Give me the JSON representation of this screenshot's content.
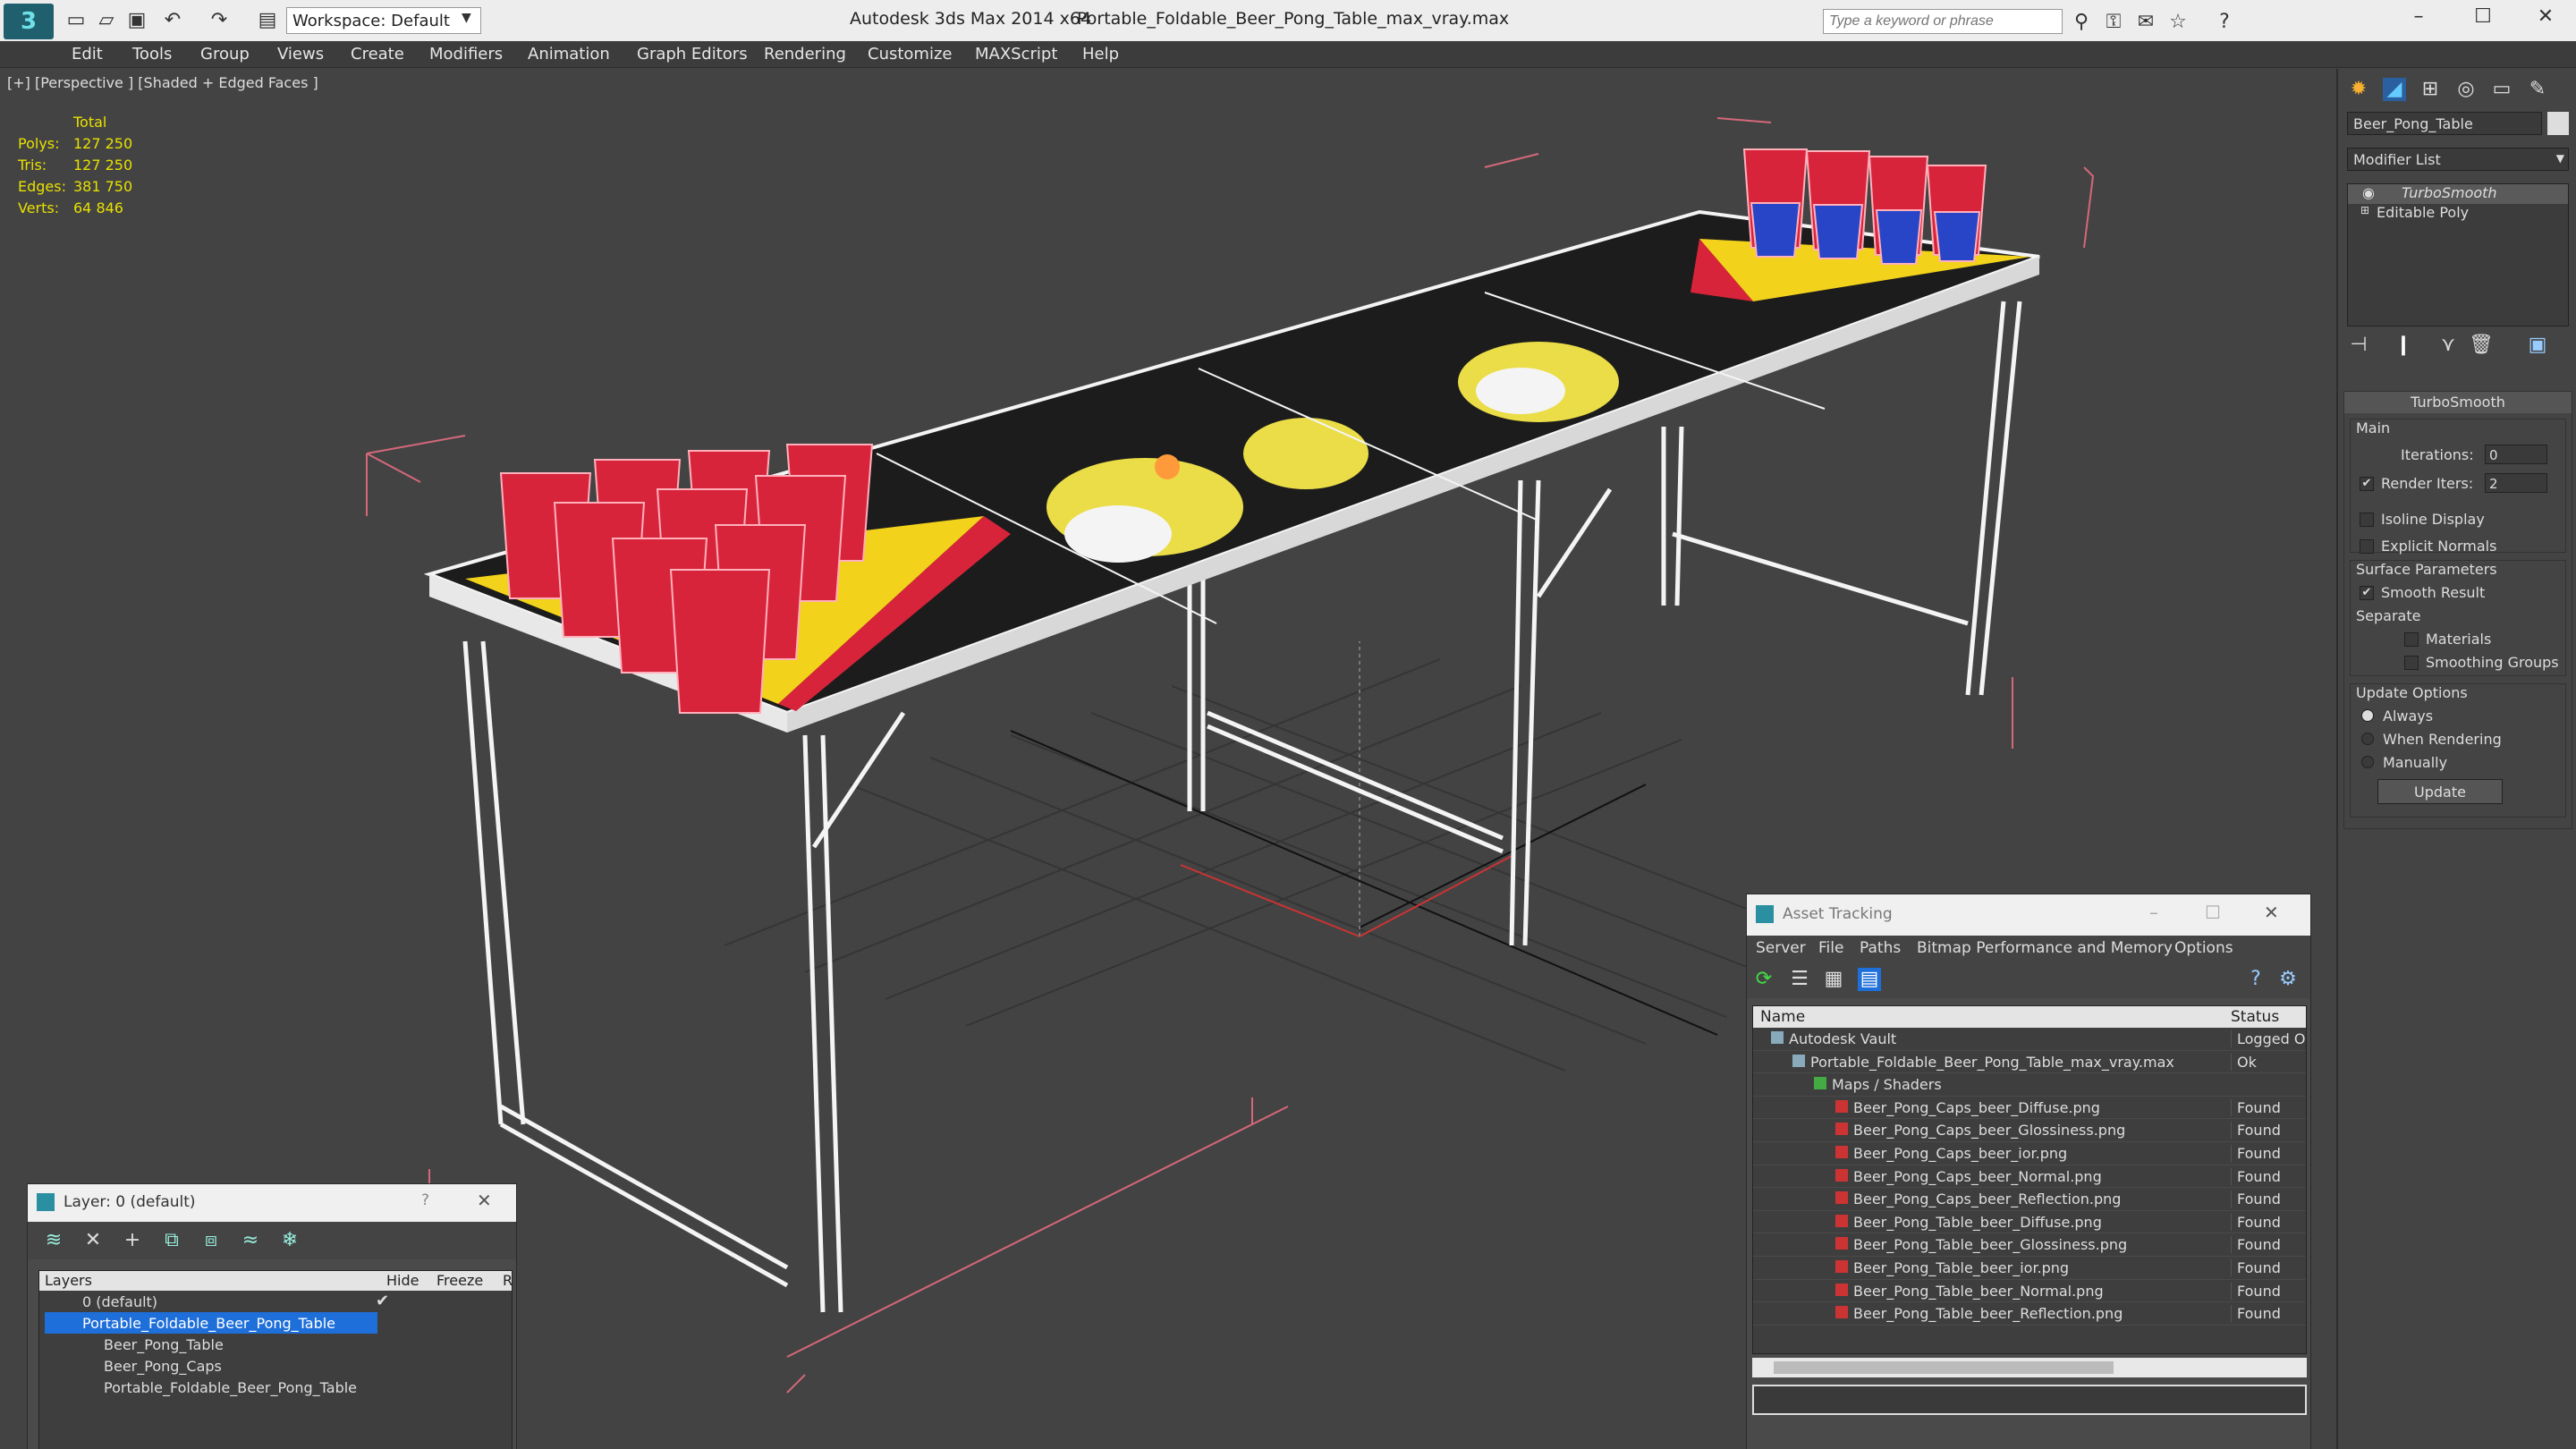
{
  "titlebar": {
    "app_title": "Autodesk 3ds Max  2014 x64",
    "file_title": "Portable_Foldable_Beer_Pong_Table_max_vray.max",
    "workspace": "Workspace: Default",
    "search_placeholder": "Type a keyword or phrase"
  },
  "menu": [
    "Edit",
    "Tools",
    "Group",
    "Views",
    "Create",
    "Modifiers",
    "Animation",
    "Graph Editors",
    "Rendering",
    "Customize",
    "MAXScript",
    "Help"
  ],
  "viewport": {
    "label": "[+] [Perspective ] [Shaded + Edged Faces ]",
    "stats": {
      "header": "Total",
      "rows": [
        {
          "label": "Polys:",
          "value": "127 250"
        },
        {
          "label": "Tris:",
          "value": "127 250"
        },
        {
          "label": "Edges:",
          "value": "381 750"
        },
        {
          "label": "Verts:",
          "value": "64 846"
        }
      ]
    }
  },
  "command_panel": {
    "object_name": "Beer_Pong_Table",
    "modifier_list": "Modifier List",
    "stack": [
      "TurboSmooth",
      "Editable Poly"
    ],
    "rollout_title": "TurboSmooth",
    "main_label": "Main",
    "iterations_label": "Iterations:",
    "iterations_value": "0",
    "render_iters_label": "Render Iters:",
    "render_iters_value": "2",
    "isoline": "Isoline Display",
    "explicit_normals": "Explicit Normals",
    "surface_params": "Surface Parameters",
    "smooth_result": "Smooth Result",
    "separate": "Separate",
    "materials": "Materials",
    "smoothing_groups": "Smoothing Groups",
    "update_options": "Update Options",
    "always": "Always",
    "when_rendering": "When Rendering",
    "manually": "Manually",
    "update_button": "Update"
  },
  "layer_window": {
    "title": "Layer: 0 (default)",
    "help": "?",
    "columns": [
      "Layers",
      "Hide",
      "Freeze",
      "R"
    ],
    "rows": [
      {
        "name": "0 (default)",
        "indent": 1
      },
      {
        "name": "Portable_Foldable_Beer_Pong_Table",
        "indent": 1
      },
      {
        "name": "Beer_Pong_Table",
        "indent": 2
      },
      {
        "name": "Beer_Pong_Caps",
        "indent": 2
      },
      {
        "name": "Portable_Foldable_Beer_Pong_Table",
        "indent": 2
      }
    ]
  },
  "asset_window": {
    "title": "Asset Tracking",
    "menu": [
      "Server",
      "File",
      "Paths",
      "Bitmap Performance and Memory",
      "Options"
    ],
    "columns": [
      "Name",
      "Status"
    ],
    "rows": [
      {
        "name": "Autodesk Vault",
        "status": "Logged Ou",
        "indent": 0
      },
      {
        "name": "Portable_Foldable_Beer_Pong_Table_max_vray.max",
        "status": "Ok",
        "indent": 1
      },
      {
        "name": "Maps / Shaders",
        "status": "",
        "indent": 2
      },
      {
        "name": "Beer_Pong_Caps_beer_Diffuse.png",
        "status": "Found",
        "indent": 3
      },
      {
        "name": "Beer_Pong_Caps_beer_Glossiness.png",
        "status": "Found",
        "indent": 3
      },
      {
        "name": "Beer_Pong_Caps_beer_ior.png",
        "status": "Found",
        "indent": 3
      },
      {
        "name": "Beer_Pong_Caps_beer_Normal.png",
        "status": "Found",
        "indent": 3
      },
      {
        "name": "Beer_Pong_Caps_beer_Reflection.png",
        "status": "Found",
        "indent": 3
      },
      {
        "name": "Beer_Pong_Table_beer_Diffuse.png",
        "status": "Found",
        "indent": 3
      },
      {
        "name": "Beer_Pong_Table_beer_Glossiness.png",
        "status": "Found",
        "indent": 3
      },
      {
        "name": "Beer_Pong_Table_beer_ior.png",
        "status": "Found",
        "indent": 3
      },
      {
        "name": "Beer_Pong_Table_beer_Normal.png",
        "status": "Found",
        "indent": 3
      },
      {
        "name": "Beer_Pong_Table_beer_Reflection.png",
        "status": "Found",
        "indent": 3
      }
    ]
  },
  "colors": {
    "accent_blue": "#1e6fd9",
    "cup_red": "#d8243a",
    "table_yellow": "#f2d21b",
    "bounding_pink": "#d4687a"
  }
}
